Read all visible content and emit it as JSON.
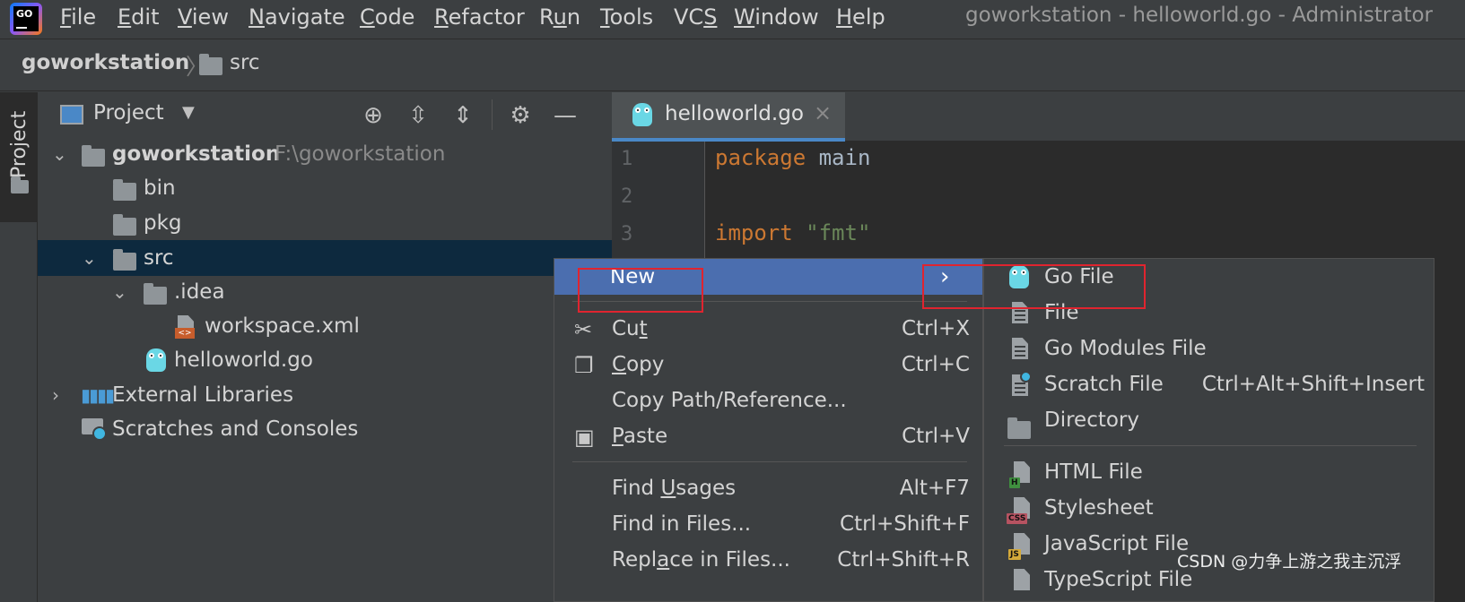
{
  "app": {
    "logo_text": "GO",
    "window_title": "goworkstation - helloworld.go - Administrator"
  },
  "menubar": {
    "items": [
      {
        "label": "File",
        "mnemonic": "F"
      },
      {
        "label": "Edit",
        "mnemonic": "E"
      },
      {
        "label": "View",
        "mnemonic": "V"
      },
      {
        "label": "Navigate",
        "mnemonic": "N"
      },
      {
        "label": "Code",
        "mnemonic": "C"
      },
      {
        "label": "Refactor",
        "mnemonic": "R"
      },
      {
        "label": "Run",
        "mnemonic": "u"
      },
      {
        "label": "Tools",
        "mnemonic": "T"
      },
      {
        "label": "VCS",
        "mnemonic": "S"
      },
      {
        "label": "Window",
        "mnemonic": "W"
      },
      {
        "label": "Help",
        "mnemonic": "H"
      }
    ]
  },
  "breadcrumb": {
    "root": "goworkstation",
    "separator": "〉",
    "current": "src"
  },
  "tool_stripe": {
    "label": "Project"
  },
  "project_panel": {
    "title": "Project",
    "icons": [
      "locate-icon",
      "expand-all-icon",
      "collapse-all-icon",
      "settings-icon",
      "hide-icon"
    ],
    "tree": [
      {
        "label": "goworkstation",
        "path": "F:\\goworkstation",
        "icon": "folder-icon"
      },
      {
        "label": "bin",
        "icon": "folder-icon"
      },
      {
        "label": "pkg",
        "icon": "folder-icon"
      },
      {
        "label": "src",
        "icon": "folder-icon",
        "selected": true
      },
      {
        "label": ".idea",
        "icon": "folder-icon"
      },
      {
        "label": "workspace.xml",
        "icon": "xml-file-icon"
      },
      {
        "label": "helloworld.go",
        "icon": "gopher-icon"
      },
      {
        "label": "External Libraries",
        "icon": "libraries-icon"
      },
      {
        "label": "Scratches and Consoles",
        "icon": "scratches-icon"
      }
    ]
  },
  "editor": {
    "tab": {
      "label": "helloworld.go",
      "close": "×"
    },
    "lines": [
      {
        "number": "1",
        "keyword": "package",
        "rest": "main"
      },
      {
        "number": "2",
        "keyword": "",
        "rest": ""
      },
      {
        "number": "3",
        "keyword": "import",
        "rest": "\"fmt\""
      }
    ]
  },
  "context_menu": {
    "items": [
      {
        "label": "New",
        "shortcut": "",
        "icon": "",
        "submenu_arrow": "›"
      },
      {
        "label": "Cut",
        "mnemonic": "t",
        "shortcut": "Ctrl+X",
        "icon": "scissors-icon"
      },
      {
        "label": "Copy",
        "mnemonic": "C",
        "shortcut": "Ctrl+C",
        "icon": "copy-icon"
      },
      {
        "label": "Copy Path/Reference...",
        "shortcut": "",
        "icon": ""
      },
      {
        "label": "Paste",
        "mnemonic": "P",
        "shortcut": "Ctrl+V",
        "icon": "paste-icon"
      },
      {
        "label": "Find Usages",
        "mnemonic": "U",
        "shortcut": "Alt+F7",
        "icon": ""
      },
      {
        "label": "Find in Files...",
        "shortcut": "Ctrl+Shift+F",
        "icon": ""
      },
      {
        "label": "Replace in Files...",
        "mnemonic": "a",
        "shortcut": "Ctrl+Shift+R",
        "icon": ""
      }
    ]
  },
  "new_submenu": {
    "items": [
      {
        "label": "Go File",
        "shortcut": "",
        "icon": "gopher-icon"
      },
      {
        "label": "File",
        "shortcut": "",
        "icon": "file-icon"
      },
      {
        "label": "Go Modules File",
        "shortcut": "",
        "icon": "file-icon"
      },
      {
        "label": "Scratch File",
        "shortcut": "Ctrl+Alt+Shift+Insert",
        "icon": "scratch-file-icon"
      },
      {
        "label": "Directory",
        "shortcut": "",
        "icon": "folder-icon"
      },
      {
        "label": "HTML File",
        "shortcut": "",
        "icon": "html-file-icon",
        "badge": "H"
      },
      {
        "label": "Stylesheet",
        "shortcut": "",
        "icon": "css-file-icon",
        "badge": "CSS"
      },
      {
        "label": "JavaScript File",
        "shortcut": "",
        "icon": "js-file-icon",
        "badge": "JS"
      },
      {
        "label": "TypeScript File",
        "shortcut": "",
        "icon": "ts-file-icon"
      }
    ]
  },
  "watermark": "CSDN @力争上游之我主沉浮",
  "colors": {
    "background": "#3c3f41",
    "editor_bg": "#2b2b2b",
    "selection": "#0d293e",
    "menu_highlight": "#4b6eaf",
    "annotation_red": "#e0242f",
    "keyword": "#cc7832",
    "string": "#6a8759"
  }
}
